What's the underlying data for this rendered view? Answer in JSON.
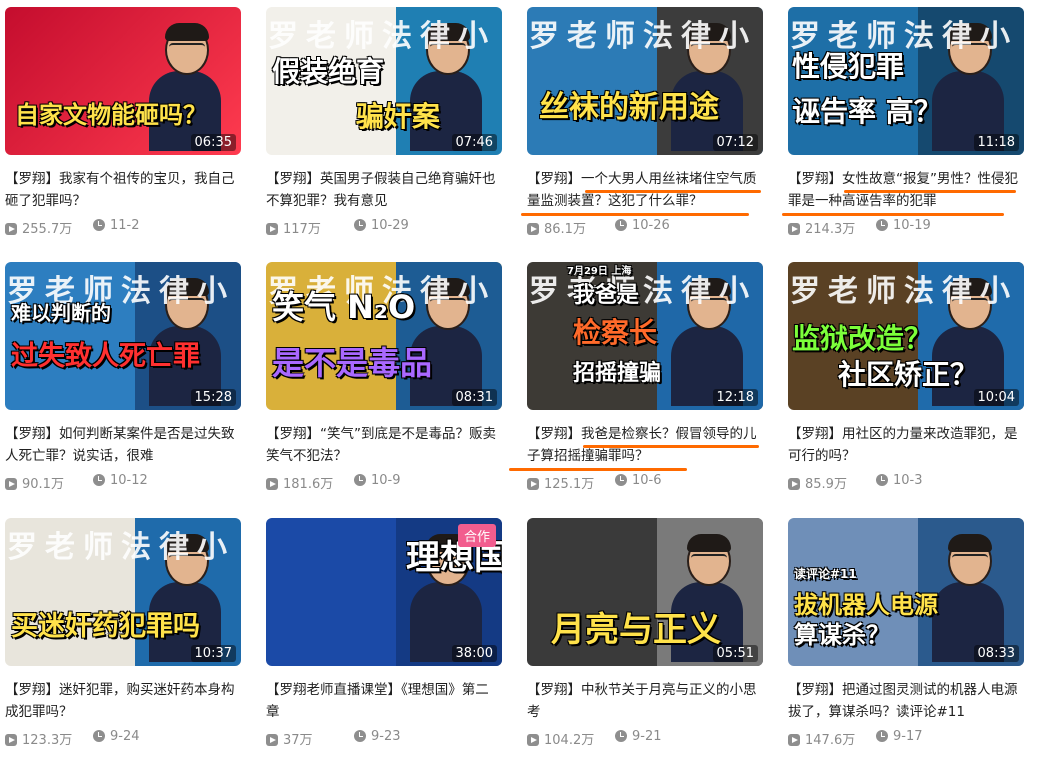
{
  "videos": [
    {
      "title": "【罗翔】我家有个祖传的宝贝，我自己砸了犯罪吗？",
      "views": "255.7万",
      "date": "11-2",
      "duration": "06:35",
      "caption": [
        "自家文物能砸吗？"
      ],
      "badge": null
    },
    {
      "title": "【罗翔】英国男子假装自己绝育骗奸也不算犯罪？我有意见",
      "views": "117万",
      "date": "10-29",
      "duration": "07:46",
      "caption": [
        "假装绝育",
        "骗奸案"
      ],
      "badge": null
    },
    {
      "title": "【罗翔】一个大男人用丝袜堵住空气质量监测装置？这犯了什么罪？",
      "views": "86.1万",
      "date": "10-26",
      "duration": "07:12",
      "caption": [
        "丝袜的新用途"
      ],
      "badge": null
    },
    {
      "title": "【罗翔】女性故意“报复”男性？性侵犯罪是一种高诬告率的犯罪",
      "views": "214.3万",
      "date": "10-19",
      "duration": "11:18",
      "caption": [
        "性侵犯罪",
        "诬告率 高？"
      ],
      "badge": null
    },
    {
      "title": "【罗翔】如何判断某案件是否是过失致人死亡罪？说实话，很难",
      "views": "90.1万",
      "date": "10-12",
      "duration": "15:28",
      "caption": [
        "难以判断的",
        "过失致人死亡罪"
      ],
      "badge": null
    },
    {
      "title": "【罗翔】“笑气”到底是不是毒品？贩卖笑气不犯法？",
      "views": "181.6万",
      "date": "10-9",
      "duration": "08:31",
      "caption": [
        "笑气 N₂O",
        "是不是毒品"
      ],
      "badge": null
    },
    {
      "title": "【罗翔】我爸是检察长？假冒领导的儿子算招摇撞骗罪吗？",
      "views": "125.1万",
      "date": "10-6",
      "duration": "12:18",
      "caption": [
        "7月29日 上海",
        "我爸是",
        "检察长",
        "招摇撞骗"
      ],
      "badge": null
    },
    {
      "title": "【罗翔】用社区的力量来改造罪犯，是可行的吗？",
      "views": "85.9万",
      "date": "10-3",
      "duration": "10:04",
      "caption": [
        "监狱改造？",
        "社区矫正？"
      ],
      "badge": null
    },
    {
      "title": "【罗翔】迷奸犯罪，购买迷奸药本身构成犯罪吗？",
      "views": "123.3万",
      "date": "9-24",
      "duration": "10:37",
      "caption": [
        "买迷奸药犯罪吗"
      ],
      "badge": null
    },
    {
      "title": "【罗翔老师直播课堂】《理想国》第二章",
      "views": "37万",
      "date": "9-23",
      "duration": "38:00",
      "caption": [
        "理想国"
      ],
      "badge": "合作"
    },
    {
      "title": "【罗翔】中秋节关于月亮与正义的小思考",
      "views": "104.2万",
      "date": "9-21",
      "duration": "05:51",
      "caption": [
        "月亮与正义"
      ],
      "badge": null
    },
    {
      "title": "【罗翔】把通过图灵测试的机器人电源拔了，算谋杀吗？读评论#11",
      "views": "147.6万",
      "date": "9-17",
      "duration": "08:33",
      "caption": [
        "读评论#11",
        "拔机器人电源",
        "算谋杀？"
      ],
      "badge": null
    }
  ],
  "channel_watermark": "罗老师法律小",
  "colors": {
    "highlight": "#ff6a00",
    "meta": "#8a8a8a",
    "badge": "#f25d8e"
  }
}
